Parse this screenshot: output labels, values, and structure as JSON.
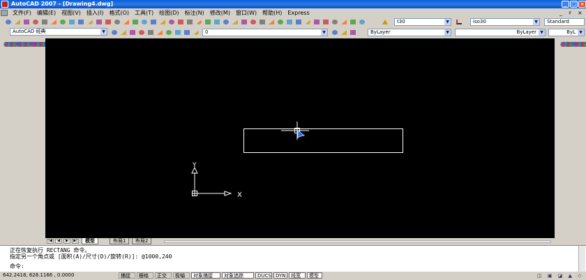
{
  "app": {
    "title": "AutoCAD 2007 - [Drawing4.dwg]",
    "min": "_",
    "max": "□",
    "close": "×"
  },
  "menu": {
    "items": [
      "文件(F)",
      "编辑(E)",
      "视图(V)",
      "插入(I)",
      "格式(O)",
      "工具(T)",
      "绘图(D)",
      "标注(N)",
      "修改(M)",
      "窗口(W)",
      "帮助(H)",
      "Express"
    ],
    "mdi_min": "_",
    "mdi_restore": "♯",
    "mdi_close": "×"
  },
  "toolbars": {
    "workspace": "AutoCAD 经典",
    "layer": "0",
    "text_style": "t30",
    "dim_style": "iso30",
    "table_style": "Standard",
    "color": "ByLayer",
    "linetype": "ByLayer",
    "lineweight": "ByL"
  },
  "drawing": {
    "ucs_y": "Y",
    "ucs_x": "X"
  },
  "layout_tabs": [
    "模型",
    "布局1",
    "布局2"
  ],
  "command": {
    "line1": "正在恢复执行 RECTANG 命令。",
    "line2": "指定另一个角点或 [面积(A)/尺寸(D)/旋转(R)]: @1000,240",
    "prompt": "命令:"
  },
  "status": {
    "coords": "642.2418,  628.1166 , 0.0000",
    "buttons": [
      "捕捉",
      "栅格",
      "正交",
      "极轴",
      "对象捕捉",
      "对象追踪",
      "DUCS",
      "DYN",
      "线宽",
      "模型"
    ],
    "active": [
      "对象捕捉",
      "对象追踪",
      "DUCS",
      "DYN",
      "线宽",
      "模型"
    ]
  },
  "colors": {
    "canvas": "#000000",
    "titlebar": "#0a5fd8",
    "drawing_lines": "#ffffff",
    "cursor_arrow": "#4a90ff"
  }
}
